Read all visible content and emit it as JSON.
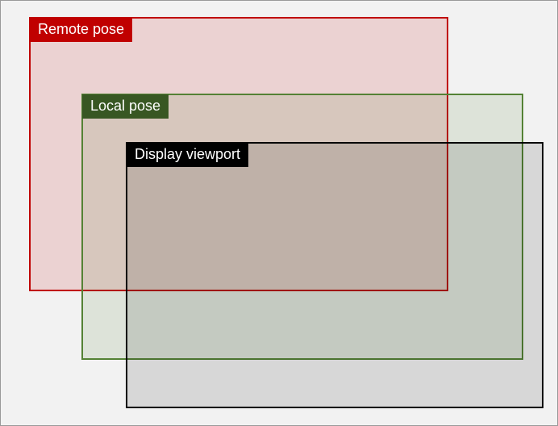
{
  "boxes": {
    "remote_pose": {
      "label": "Remote pose"
    },
    "local_pose": {
      "label": "Local pose"
    },
    "display_viewport": {
      "label": "Display viewport"
    }
  }
}
